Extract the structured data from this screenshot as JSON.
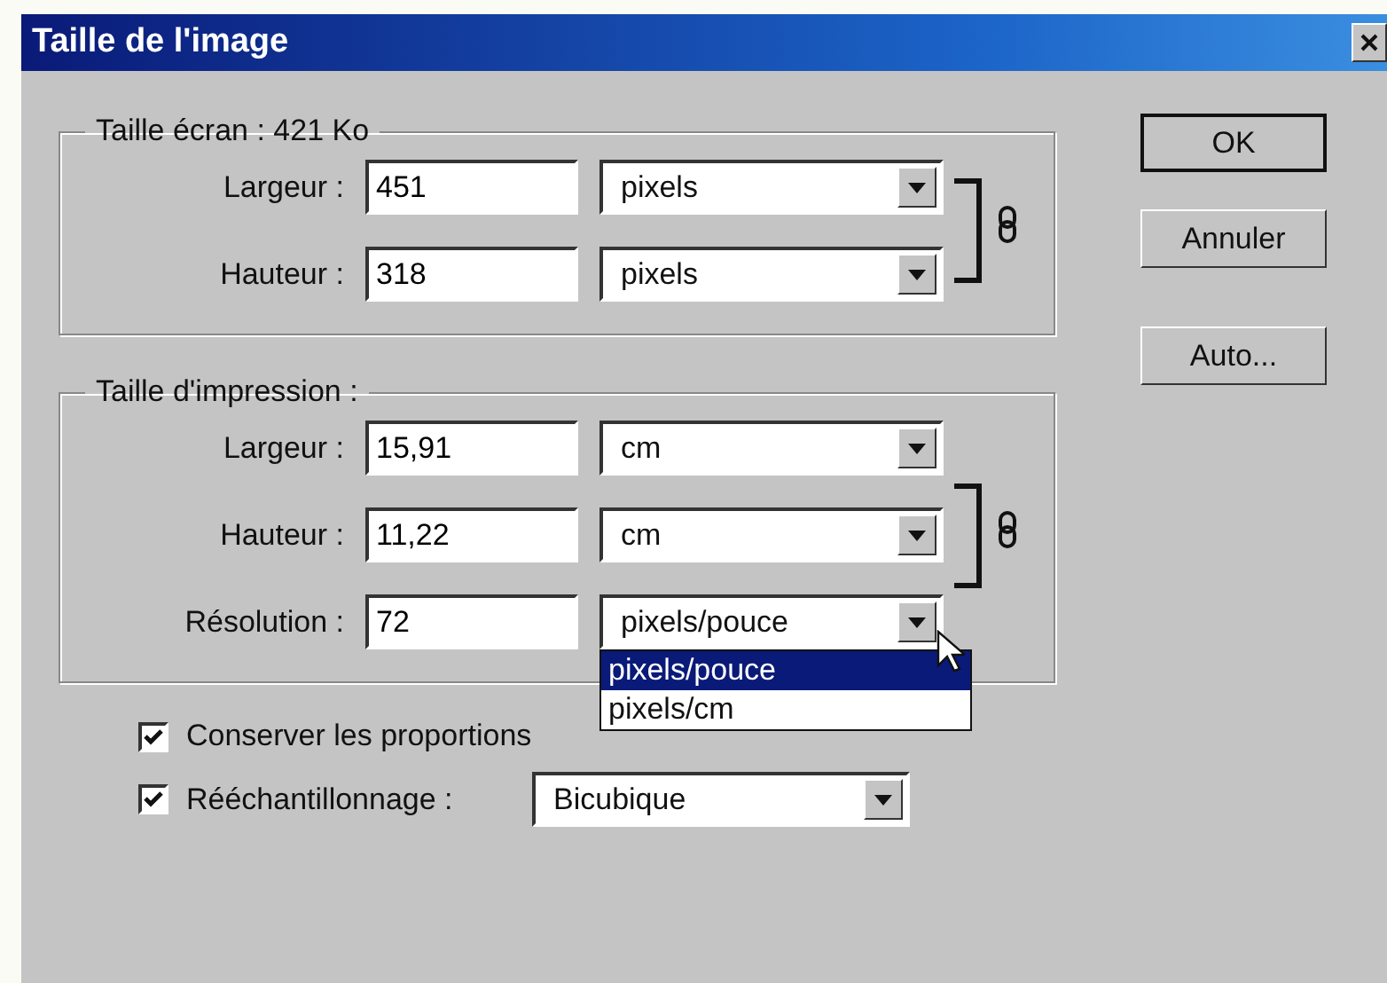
{
  "window": {
    "title": "Taille de l'image"
  },
  "screen_size": {
    "legend": "Taille écran : 421 Ko",
    "linked": true,
    "rows": [
      {
        "label": "Largeur :",
        "value": "451",
        "unit": "pixels"
      },
      {
        "label": "Hauteur :",
        "value": "318",
        "unit": "pixels"
      }
    ]
  },
  "print_size": {
    "legend": "Taille d'impression :",
    "linked": true,
    "rows": [
      {
        "label": "Largeur :",
        "value": "15,91",
        "unit": "cm"
      },
      {
        "label": "Hauteur :",
        "value": "11,22",
        "unit": "cm"
      },
      {
        "label": "Résolution :",
        "value": "72",
        "unit": "pixels/pouce",
        "open": true,
        "options": [
          {
            "label": "pixels/pouce",
            "selected": true
          },
          {
            "label": "pixels/cm",
            "selected": false
          }
        ]
      }
    ]
  },
  "options": [
    {
      "kind": "checkbox",
      "label": "Conserver les proportions",
      "checked": true
    },
    {
      "kind": "select",
      "label": "Rééchantillonnage :",
      "checked": true,
      "value": "Bicubique"
    }
  ],
  "buttons": [
    {
      "label": "OK",
      "default": true
    },
    {
      "label": "Annuler",
      "default": false
    },
    {
      "label": "Auto...",
      "default": false
    }
  ]
}
